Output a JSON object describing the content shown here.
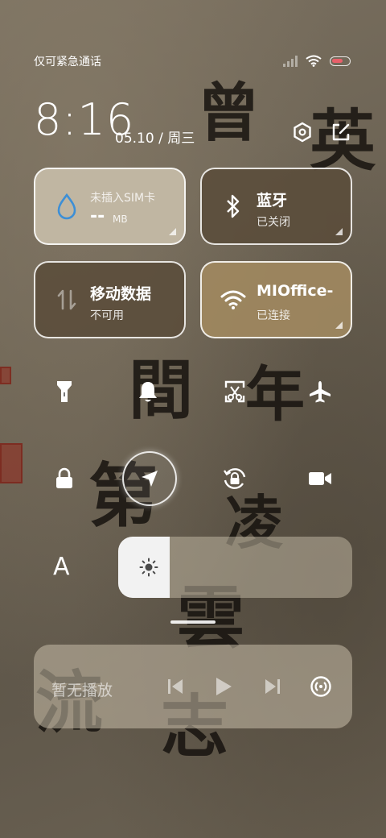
{
  "status_bar": {
    "carrier": "仅可紧急通话",
    "battery_level": 0.7,
    "battery_color": "#e8606a",
    "icons": [
      "signal-icon",
      "wifi-icon",
      "battery-icon"
    ]
  },
  "header": {
    "time": "8:16",
    "date": "05.10 / 周三",
    "icons": [
      "settings-hexagon-icon",
      "edit-icon"
    ]
  },
  "tiles": {
    "data_usage": {
      "title": "未插入SIM卡",
      "value": "--",
      "unit": "MB",
      "icon": "water-drop-icon",
      "accent": "#3d8fd6"
    },
    "bluetooth": {
      "title": "蓝牙",
      "status": "已关闭",
      "icon": "bluetooth-icon"
    },
    "mobile_data": {
      "title": "移动数据",
      "status": "不可用",
      "icon": "arrows-updown-icon"
    },
    "wifi": {
      "title": "MIOffice-",
      "status": "已连接",
      "icon": "wifi-icon"
    }
  },
  "toggles": {
    "row1": [
      "flashlight-icon",
      "bell-icon",
      "screenshot-icon",
      "airplane-icon"
    ],
    "row2": [
      "lock-icon",
      "location-icon",
      "rotation-lock-icon",
      "video-icon"
    ]
  },
  "brightness": {
    "auto_label": "A",
    "level": 0.22
  },
  "media": {
    "title": "暂无播放",
    "controls": [
      "previous-icon",
      "play-icon",
      "next-icon",
      "cast-icon"
    ]
  },
  "wallpaper": {
    "glyphs": [
      "曾",
      "英",
      "間",
      "年",
      "第",
      "凌",
      "雲",
      "流",
      "志"
    ]
  }
}
